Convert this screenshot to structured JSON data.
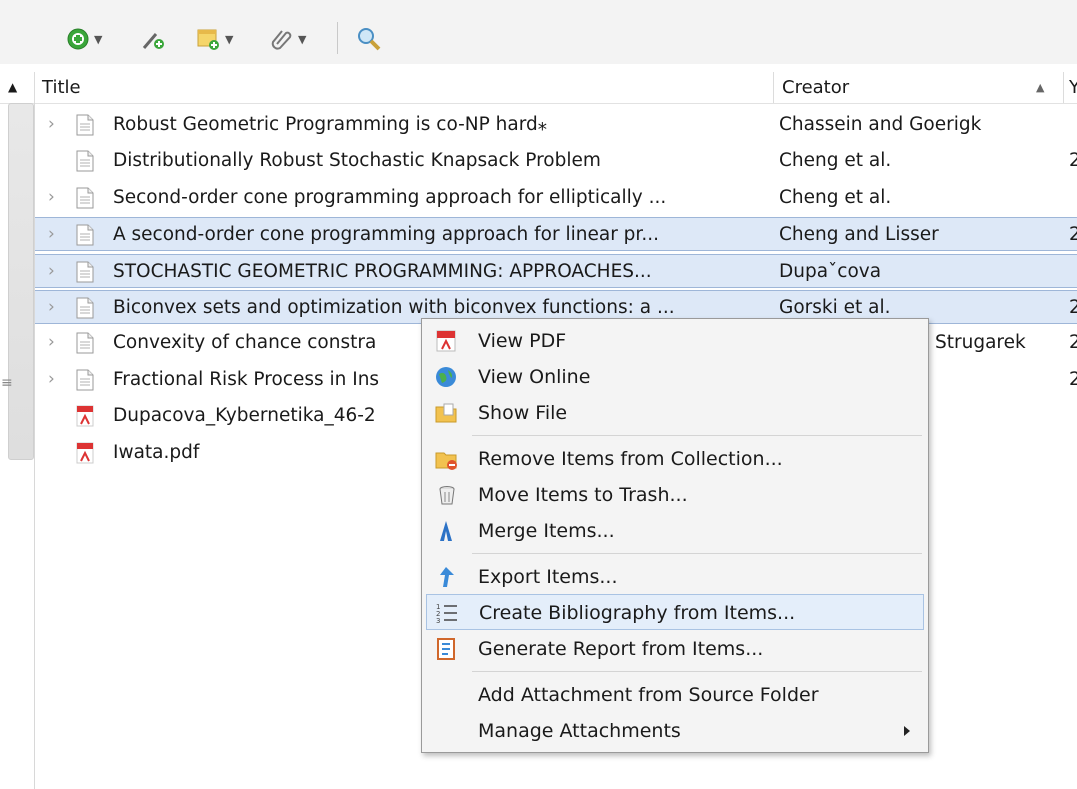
{
  "columns": {
    "title": "Title",
    "creator": "Creator",
    "year_partial": "Y"
  },
  "rows": [
    {
      "title": "Robust Geometric Programming is co-NP hard⁎",
      "creator": "Chassein and Goerigk",
      "year": "",
      "icon": "document-icon",
      "expandable": true,
      "selected": false
    },
    {
      "title": "Distributionally Robust Stochastic Knapsack Problem",
      "creator": "Cheng et al.",
      "year": "2",
      "icon": "document-icon",
      "expandable": false,
      "selected": false
    },
    {
      "title": "Second-order cone programming approach for elliptically ...",
      "creator": "Cheng et al.",
      "year": "",
      "icon": "document-icon",
      "expandable": true,
      "selected": false
    },
    {
      "title": "A second-order cone programming approach for linear pr...",
      "creator": "Cheng and Lisser",
      "year": "2",
      "icon": "document-icon",
      "expandable": true,
      "selected": true
    },
    {
      "title": "STOCHASTIC GEOMETRIC PROGRAMMING: APPROACHES...",
      "creator": "Dupaˇcova",
      "year": "",
      "icon": "document-icon",
      "expandable": true,
      "selected": true
    },
    {
      "title": "Biconvex sets and optimization with biconvex functions: a ...",
      "creator": "Gorski et al.",
      "year": "2",
      "icon": "document-icon",
      "expandable": true,
      "selected": true
    },
    {
      "title": "Convexity of chance constra",
      "creator": "Strugarek",
      "year": "2",
      "icon": "document-icon",
      "expandable": true,
      "selected": false
    },
    {
      "title": "Fractional Risk Process in Ins",
      "creator": "",
      "year": "2",
      "icon": "document-icon",
      "expandable": true,
      "selected": false
    },
    {
      "title": "Dupacova_Kybernetika_46-2",
      "creator": "",
      "year": "",
      "icon": "pdf-icon",
      "expandable": false,
      "selected": false
    },
    {
      "title": "Iwata.pdf",
      "creator": "",
      "year": "",
      "icon": "pdf-icon",
      "expandable": false,
      "selected": false
    }
  ],
  "context_menu": {
    "view_pdf": "View PDF",
    "view_online": "View Online",
    "show_file": "Show File",
    "remove_from_collection": "Remove Items from Collection...",
    "move_to_trash": "Move Items to Trash...",
    "merge_items": "Merge Items...",
    "export_items": "Export Items...",
    "create_bibliography": "Create Bibliography from Items...",
    "generate_report": "Generate Report from Items...",
    "add_attachment": "Add Attachment from Source Folder",
    "manage_attachments": "Manage Attachments"
  },
  "colors": {
    "selection": "#dde8f7",
    "selection_border": "#9eb6d8",
    "menu_bg": "#f4f4f4",
    "menu_highlight": "#e4eefa"
  }
}
